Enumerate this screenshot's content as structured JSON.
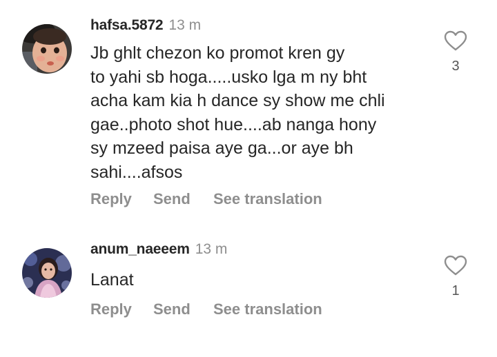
{
  "comments": [
    {
      "username": "hafsa.5872",
      "time": "13 m",
      "lines": [
        "Jb ghlt chezon ko promot kren gy",
        "to yahi sb hoga.....usko lga m ny bht",
        "acha kam kia h dance sy show me chli",
        "gae..photo shot hue....ab nanga hony",
        "sy mzeed paisa aye ga...or aye bh",
        "sahi....afsos"
      ],
      "actions": {
        "reply": "Reply",
        "send": "Send",
        "translate": "See translation"
      },
      "likes": "3",
      "avatar_icon": "child-avatar-icon"
    },
    {
      "username": "anum_naeeem",
      "time": "13 m",
      "lines": [
        "Lanat"
      ],
      "actions": {
        "reply": "Reply",
        "send": "Send",
        "translate": "See translation"
      },
      "likes": "1",
      "avatar_icon": "girl-avatar-icon"
    }
  ],
  "colors": {
    "text": "#262626",
    "secondary": "#8e8e8e",
    "heart_outline": "#8e8e8e"
  }
}
